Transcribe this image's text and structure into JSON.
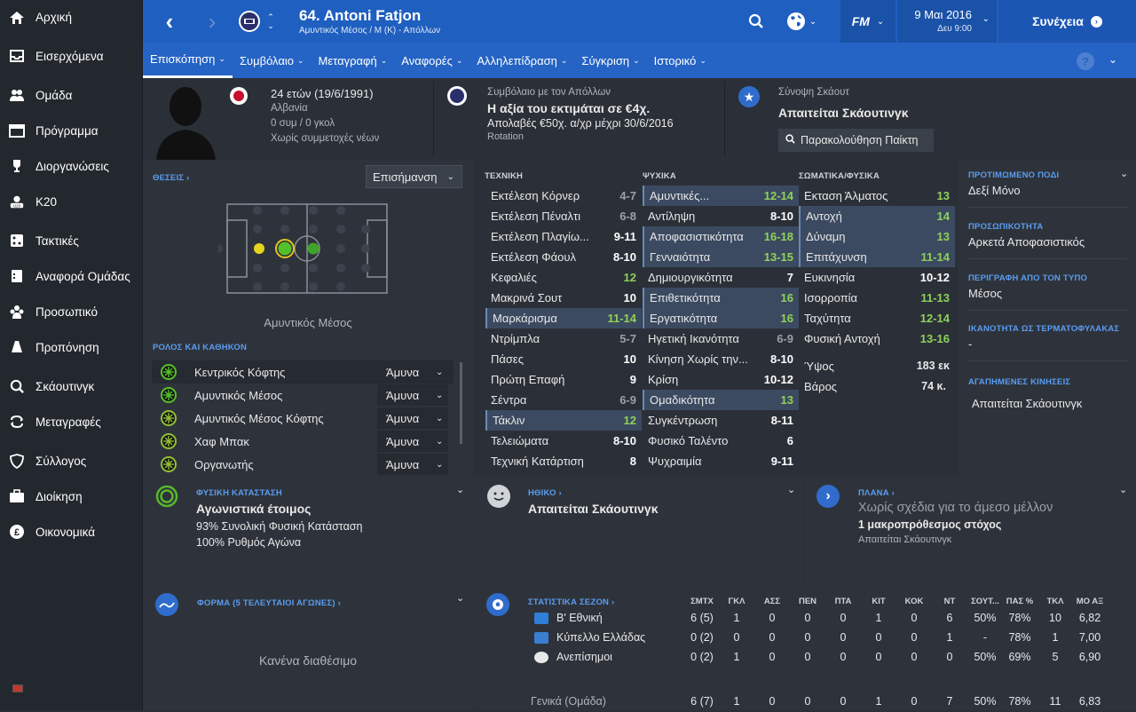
{
  "sidebar": {
    "items": [
      {
        "label": "Αρχική",
        "icon": "home-icon"
      },
      {
        "label": "Εισερχόμενα",
        "icon": "inbox-icon"
      },
      {
        "label": "Ομάδα",
        "icon": "squad-icon"
      },
      {
        "label": "Πρόγραμμα",
        "icon": "calendar-icon"
      },
      {
        "label": "Διοργανώσεις",
        "icon": "trophy-icon"
      },
      {
        "label": "Κ20",
        "icon": "u20-icon"
      },
      {
        "label": "Τακτικές",
        "icon": "tactics-icon"
      },
      {
        "label": "Αναφορά Ομάδας",
        "icon": "report-icon"
      },
      {
        "label": "Προσωπικό",
        "icon": "staff-icon"
      },
      {
        "label": "Προπόνηση",
        "icon": "training-icon"
      },
      {
        "label": "Σκάουτινγκ",
        "icon": "search-icon"
      },
      {
        "label": "Μεταγραφές",
        "icon": "transfers-icon"
      },
      {
        "label": "Σύλλογος",
        "icon": "shield-icon"
      },
      {
        "label": "Διοίκηση",
        "icon": "briefcase-icon"
      },
      {
        "label": "Οικονομικά",
        "icon": "pound-icon"
      }
    ]
  },
  "header": {
    "title": "64. Antoni Fatjon",
    "subtitle": "Αμυντικός Μέσος / Μ (Κ) - Απόλλων",
    "date": "9 Μαι 2016",
    "day_time": "Δευ 9:00",
    "continue": "Συνέχεια",
    "fm_logo": "FM"
  },
  "tabs": [
    {
      "label": "Επισκόπηση"
    },
    {
      "label": "Συμβόλαιο"
    },
    {
      "label": "Μεταγραφή"
    },
    {
      "label": "Αναφορές"
    },
    {
      "label": "Αλληλεπίδραση"
    },
    {
      "label": "Σύγκριση"
    },
    {
      "label": "Ιστορικό"
    }
  ],
  "profile": {
    "age": "24 ετών (19/6/1991)",
    "nationality": "Αλβανία",
    "caps": "0 συμ / 0 γκολ",
    "youth": "Χωρίς συμμετοχές νέων"
  },
  "contract": {
    "label": "Συμβόλαιο με τον Απόλλων",
    "value": "Η αξία του εκτιμάται σε €4χ.",
    "wage": "Απολαβές €50χ. α/χρ μέχρι 30/6/2016",
    "status": "Rotation"
  },
  "scout": {
    "label": "Σύνοψη Σκάουτ",
    "value": "Απαιτείται Σκάουτινγκ",
    "button": "Παρακολούθηση Παίκτη"
  },
  "positions": {
    "label": "ΘΕΣΕΙΣ",
    "dropdown": "Επισήμανση",
    "position_name": "Αμυντικός Μέσος"
  },
  "roles": {
    "label": "ΡΟΛΟΣ ΚΑΙ ΚΑΘΗΚΟΝ",
    "items": [
      {
        "name": "Κεντρικός Κόφτης",
        "duty": "Άμυνα"
      },
      {
        "name": "Αμυντικός Μέσος",
        "duty": "Άμυνα"
      },
      {
        "name": "Αμυντικός Μέσος Κόφτης",
        "duty": "Άμυνα"
      },
      {
        "name": "Χαφ Μπακ",
        "duty": "Άμυνα"
      },
      {
        "name": "Οργανωτής",
        "duty": "Άμυνα"
      }
    ]
  },
  "technical": {
    "label": "ΤΕΧΝΙΚΗ",
    "items": [
      {
        "name": "Εκτέλεση Κόρνερ",
        "value": "4-7"
      },
      {
        "name": "Εκτέλεση Πέναλτι",
        "value": "6-8"
      },
      {
        "name": "Εκτέλεση Πλαγίω...",
        "value": "9-11"
      },
      {
        "name": "Εκτέλεση Φάουλ",
        "value": "8-10"
      },
      {
        "name": "Κεφαλιές",
        "value": "12"
      },
      {
        "name": "Μακρινά Σουτ",
        "value": "10"
      },
      {
        "name": "Μαρκάρισμα",
        "value": "11-14"
      },
      {
        "name": "Ντρίμπλα",
        "value": "5-7"
      },
      {
        "name": "Πάσες",
        "value": "10"
      },
      {
        "name": "Πρώτη Επαφή",
        "value": "9"
      },
      {
        "name": "Σέντρα",
        "value": "6-9"
      },
      {
        "name": "Τάκλιν",
        "value": "12"
      },
      {
        "name": "Τελειώματα",
        "value": "8-10"
      },
      {
        "name": "Τεχνική Κατάρτιση",
        "value": "8"
      }
    ]
  },
  "mental": {
    "label": "ΨΥΧΙΚΑ",
    "items": [
      {
        "name": "Αμυντικές...",
        "value": "12-14"
      },
      {
        "name": "Αντίληψη",
        "value": "8-10"
      },
      {
        "name": "Αποφασιστικότητα",
        "value": "16-18"
      },
      {
        "name": "Γενναιότητα",
        "value": "13-15"
      },
      {
        "name": "Δημιουργικότητα",
        "value": "7"
      },
      {
        "name": "Επιθετικότητα",
        "value": "16"
      },
      {
        "name": "Εργατικότητα",
        "value": "16"
      },
      {
        "name": "Ηγετική Ικανότητα",
        "value": "6-9"
      },
      {
        "name": "Κίνηση Χωρίς την...",
        "value": "8-10"
      },
      {
        "name": "Κρίση",
        "value": "10-12"
      },
      {
        "name": "Ομαδικότητα",
        "value": "13"
      },
      {
        "name": "Συγκέντρωση",
        "value": "8-11"
      },
      {
        "name": "Φυσικό Ταλέντο",
        "value": "6"
      },
      {
        "name": "Ψυχραιμία",
        "value": "9-11"
      }
    ]
  },
  "physical": {
    "label": "ΣΩΜΑΤΙΚΑ/ΦΥΣΙΚΑ",
    "items": [
      {
        "name": "Εκταση Άλματος",
        "value": "13"
      },
      {
        "name": "Αντοχή",
        "value": "14"
      },
      {
        "name": "Δύναμη",
        "value": "13"
      },
      {
        "name": "Επιτάχυνση",
        "value": "11-14"
      },
      {
        "name": "Ευκινησία",
        "value": "10-12"
      },
      {
        "name": "Ισορροπία",
        "value": "11-13"
      },
      {
        "name": "Ταχύτητα",
        "value": "12-14"
      },
      {
        "name": "Φυσική Αντοχή",
        "value": "13-16"
      }
    ],
    "height_label": "Ύψος",
    "height": "183 εκ",
    "weight_label": "Βάρος",
    "weight": "74 κ."
  },
  "info": {
    "foot_label": "ΠΡΟΤΙΜΩΜΕΝΟ ΠΟΔΙ",
    "foot": "Δεξί Μόνο",
    "personality_label": "ΠΡΟΣΩΠΙΚΟΤΗΤΑ",
    "personality": "Αρκετά Αποφασιστικός",
    "media_label": "ΠΕΡΙΓΡΑΦΗ ΑΠΟ ΤΟΝ ΤΥΠΟ",
    "media": "Μέσος",
    "gk_label": "ΙΚΑΝΟΤΗΤΑ ΩΣ ΤΕΡΜΑΤΟΦΥΛΑΚΑΣ",
    "gk": "-",
    "moves_label": "ΑΓΑΠΗΜΕΝΕΣ ΚΙΝΗΣΕΙΣ",
    "moves": "Απαιτείται Σκάουτινγκ"
  },
  "condition": {
    "label": "ΦΥΣΙΚΗ ΚΑΤΑΣΤΑΣΗ",
    "value": "Αγωνιστικά έτοιμος",
    "fitness": "93% Συνολική Φυσική Κατάσταση",
    "sharpness": "100% Ρυθμός Αγώνα"
  },
  "ethics": {
    "label": "ΗΘΙΚΟ",
    "value": "Απαιτείται Σκάουτινγκ"
  },
  "plans": {
    "label": "ΠΛΑΝΑ",
    "value": "Χωρίς σχέδια για το άμεσο μέλλον",
    "goal": "1 μακροπρόθεσμος στόχος",
    "note": "Απαιτείται Σκάουτινγκ"
  },
  "form": {
    "label": "ΦΟΡΜΑ (5 ΤΕΛΕΥΤΑΙΟΙ ΑΓΩΝΕΣ)",
    "empty": "Κανένα διαθέσιμο"
  },
  "season_stats": {
    "label": "ΣΤΑΤΙΣΤΙΚΑ ΣΕΖΟΝ",
    "headers": [
      "ΣΜΤΧ",
      "ΓΚΛ",
      "ΑΣΣ",
      "ΠΕΝ",
      "ΠΤΑ",
      "ΚΙΤ",
      "ΚΟΚ",
      "ΝΤ",
      "ΣΟΥΤ...",
      "ΠΑΣ %",
      "ΤΚΛ",
      "ΜΟ ΑΞ"
    ],
    "rows": [
      {
        "comp": "Β' Εθνική",
        "values": [
          "6 (5)",
          "1",
          "0",
          "0",
          "0",
          "1",
          "0",
          "6",
          "50%",
          "78%",
          "10",
          "6,82"
        ]
      },
      {
        "comp": "Κύπελλο Ελλάδας",
        "values": [
          "0 (2)",
          "0",
          "0",
          "0",
          "0",
          "0",
          "0",
          "1",
          "-",
          "78%",
          "1",
          "7,00"
        ]
      },
      {
        "comp": "Ανεπίσημοι",
        "values": [
          "0 (2)",
          "1",
          "0",
          "0",
          "0",
          "0",
          "0",
          "0",
          "50%",
          "69%",
          "5",
          "6,90"
        ]
      }
    ],
    "total": {
      "comp": "Γενικά (Ομάδα)",
      "values": [
        "6 (7)",
        "1",
        "0",
        "0",
        "0",
        "1",
        "0",
        "7",
        "50%",
        "78%",
        "11",
        "6,83"
      ]
    }
  },
  "colors": {
    "header_blue": "#1f5fbf",
    "nav_blue": "#2563c4",
    "sidebar": "#23272e",
    "panel": "#2e333b",
    "label_blue": "#5b9cf0",
    "green": "#8fd15a"
  }
}
